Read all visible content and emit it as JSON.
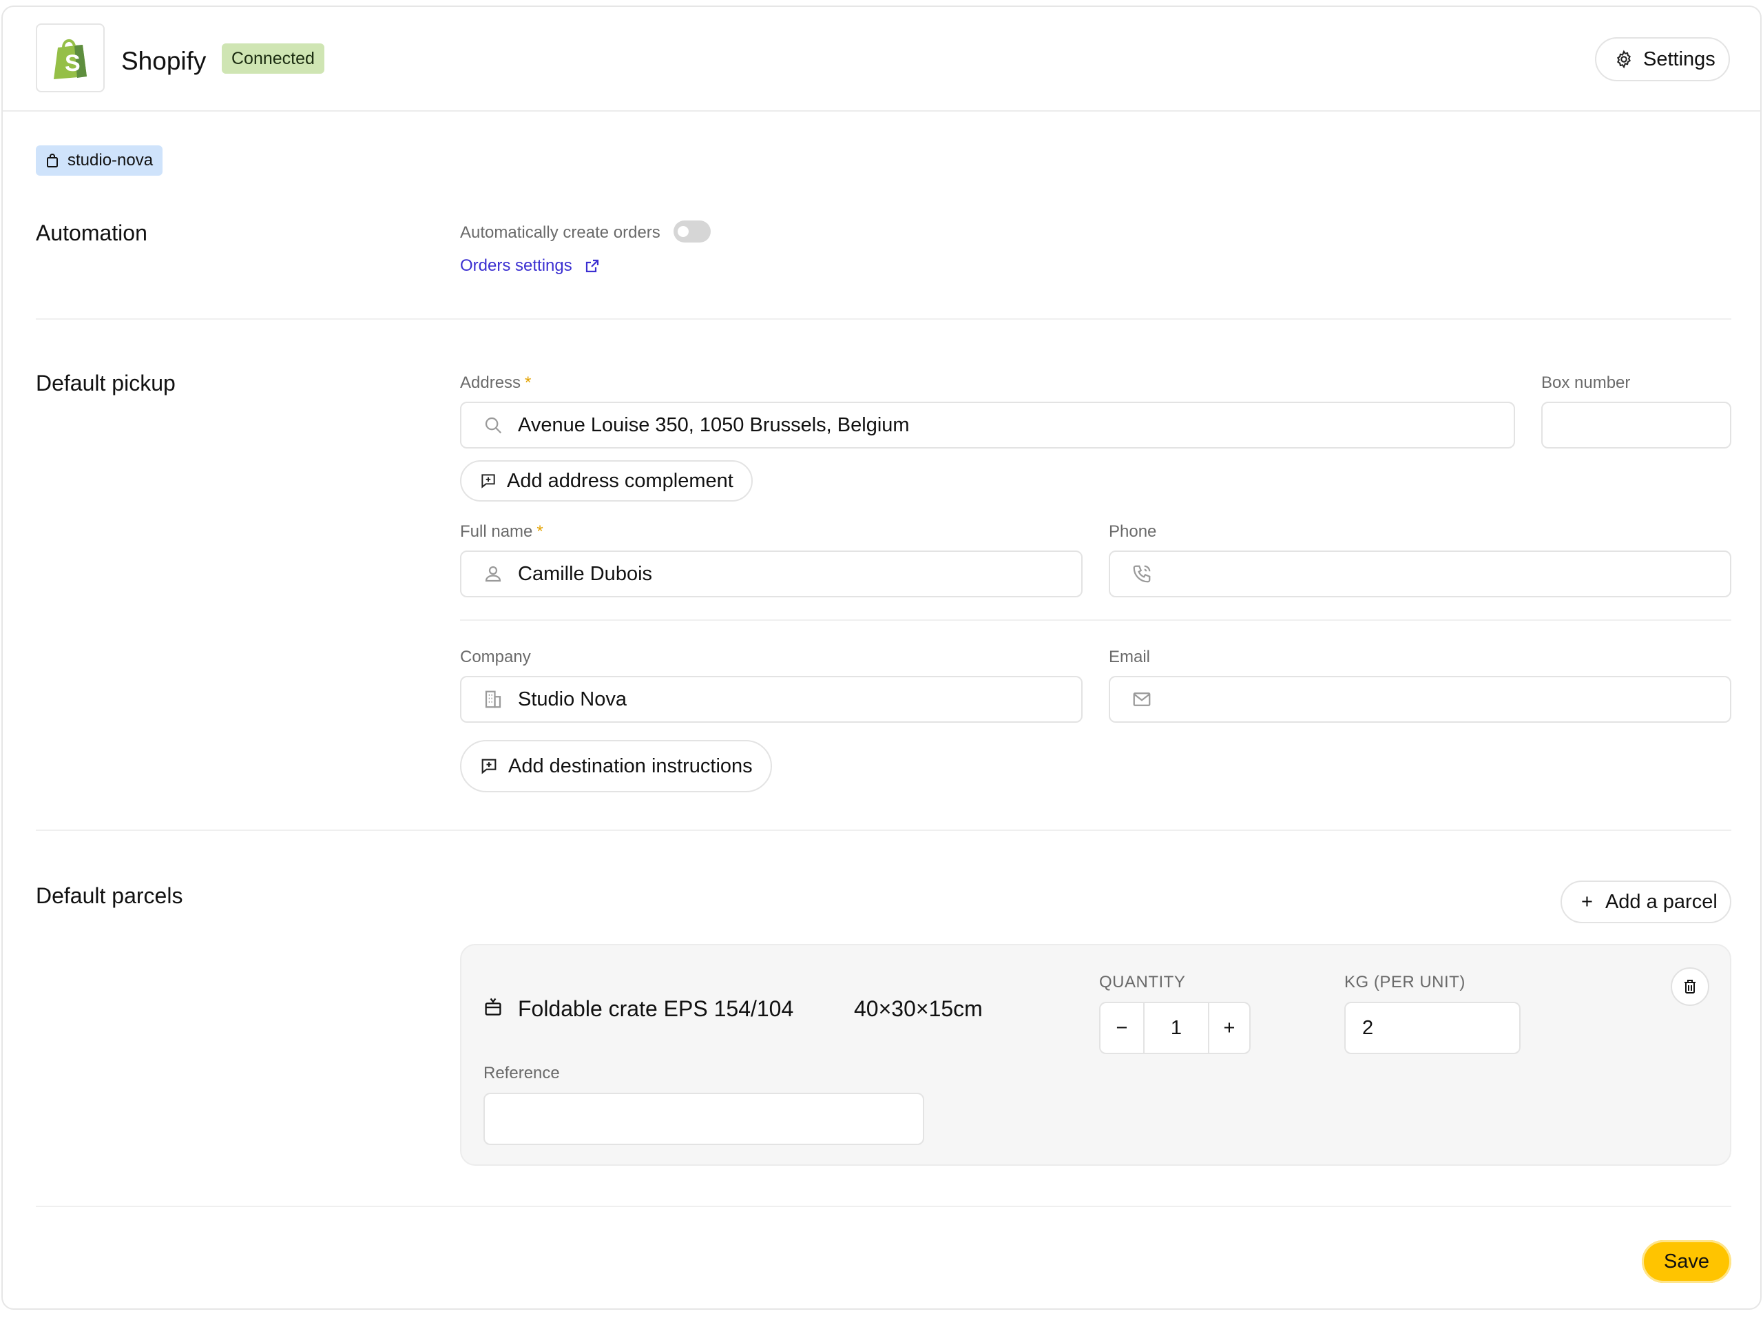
{
  "header": {
    "app_name": "Shopify",
    "status": "Connected",
    "settings_label": "Settings",
    "logo_icon": "shopify-bag-icon",
    "brand_color": "#95bf47"
  },
  "store_tag": {
    "label": "studio-nova",
    "icon": "bag-icon"
  },
  "automation": {
    "title": "Automation",
    "toggle_label": "Automatically create orders",
    "toggle_on": false,
    "orders_link": "Orders settings"
  },
  "pickup": {
    "title": "Default pickup",
    "address_label": "Address",
    "address_value": "Avenue Louise 350, 1050 Brussels, Belgium",
    "box_label": "Box number",
    "box_value": "",
    "add_complement": "Add address complement",
    "fullname_label": "Full name",
    "fullname_value": "Camille Dubois",
    "phone_label": "Phone",
    "phone_value": "",
    "company_label": "Company",
    "company_value": "Studio Nova",
    "email_label": "Email",
    "email_value": "",
    "add_instructions": "Add destination instructions",
    "required_mark": "*"
  },
  "parcels": {
    "title": "Default parcels",
    "add_label": "Add a parcel",
    "add_symbol": "+",
    "items": [
      {
        "name": "Foldable crate EPS 154/104",
        "dimensions": "40×30×15cm",
        "quantity_label": "QUANTITY",
        "quantity": "1",
        "minus": "−",
        "plus": "+",
        "kg_label": "KG (PER UNIT)",
        "kg": "2",
        "reference_label": "Reference",
        "reference": ""
      }
    ]
  },
  "footer": {
    "save_label": "Save",
    "accent": "#ffc400"
  }
}
